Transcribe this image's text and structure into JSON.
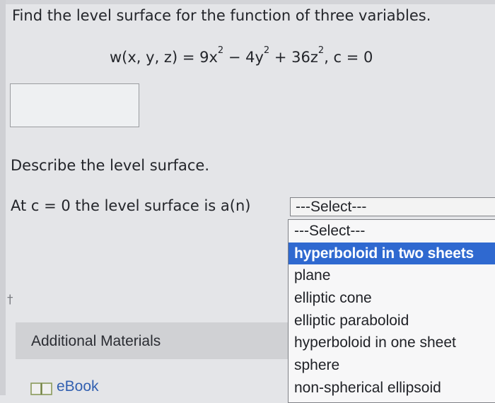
{
  "question": {
    "prompt": "Find the level surface for the function of three variables.",
    "equation": {
      "lhs": "w(x, y, z) = 9x",
      "exp1": "2",
      "mid1": " − 4y",
      "exp2": "2",
      "mid2": " + 36z",
      "exp3": "2",
      "tail": ",  c = 0"
    },
    "answer_value": ""
  },
  "describe": {
    "heading": "Describe the level surface.",
    "sentence": "At c = 0 the level surface is a(n)",
    "select": {
      "current": "---Select---",
      "options": [
        "---Select---",
        "hyperboloid in two sheets",
        "plane",
        "elliptic cone",
        "elliptic paraboloid",
        "hyperboloid in one sheet",
        "sphere",
        "non-spherical ellipsoid"
      ],
      "highlighted_option": "hyperboloid in two sheets"
    }
  },
  "footer": {
    "dagger": "†",
    "additional_materials": "Additional Materials",
    "ebook_label": "eBook",
    "ebook_icon": "book-icon"
  },
  "colors": {
    "highlight": "#2f69d0",
    "link": "#315fb0",
    "background": "#e4e5e8"
  }
}
